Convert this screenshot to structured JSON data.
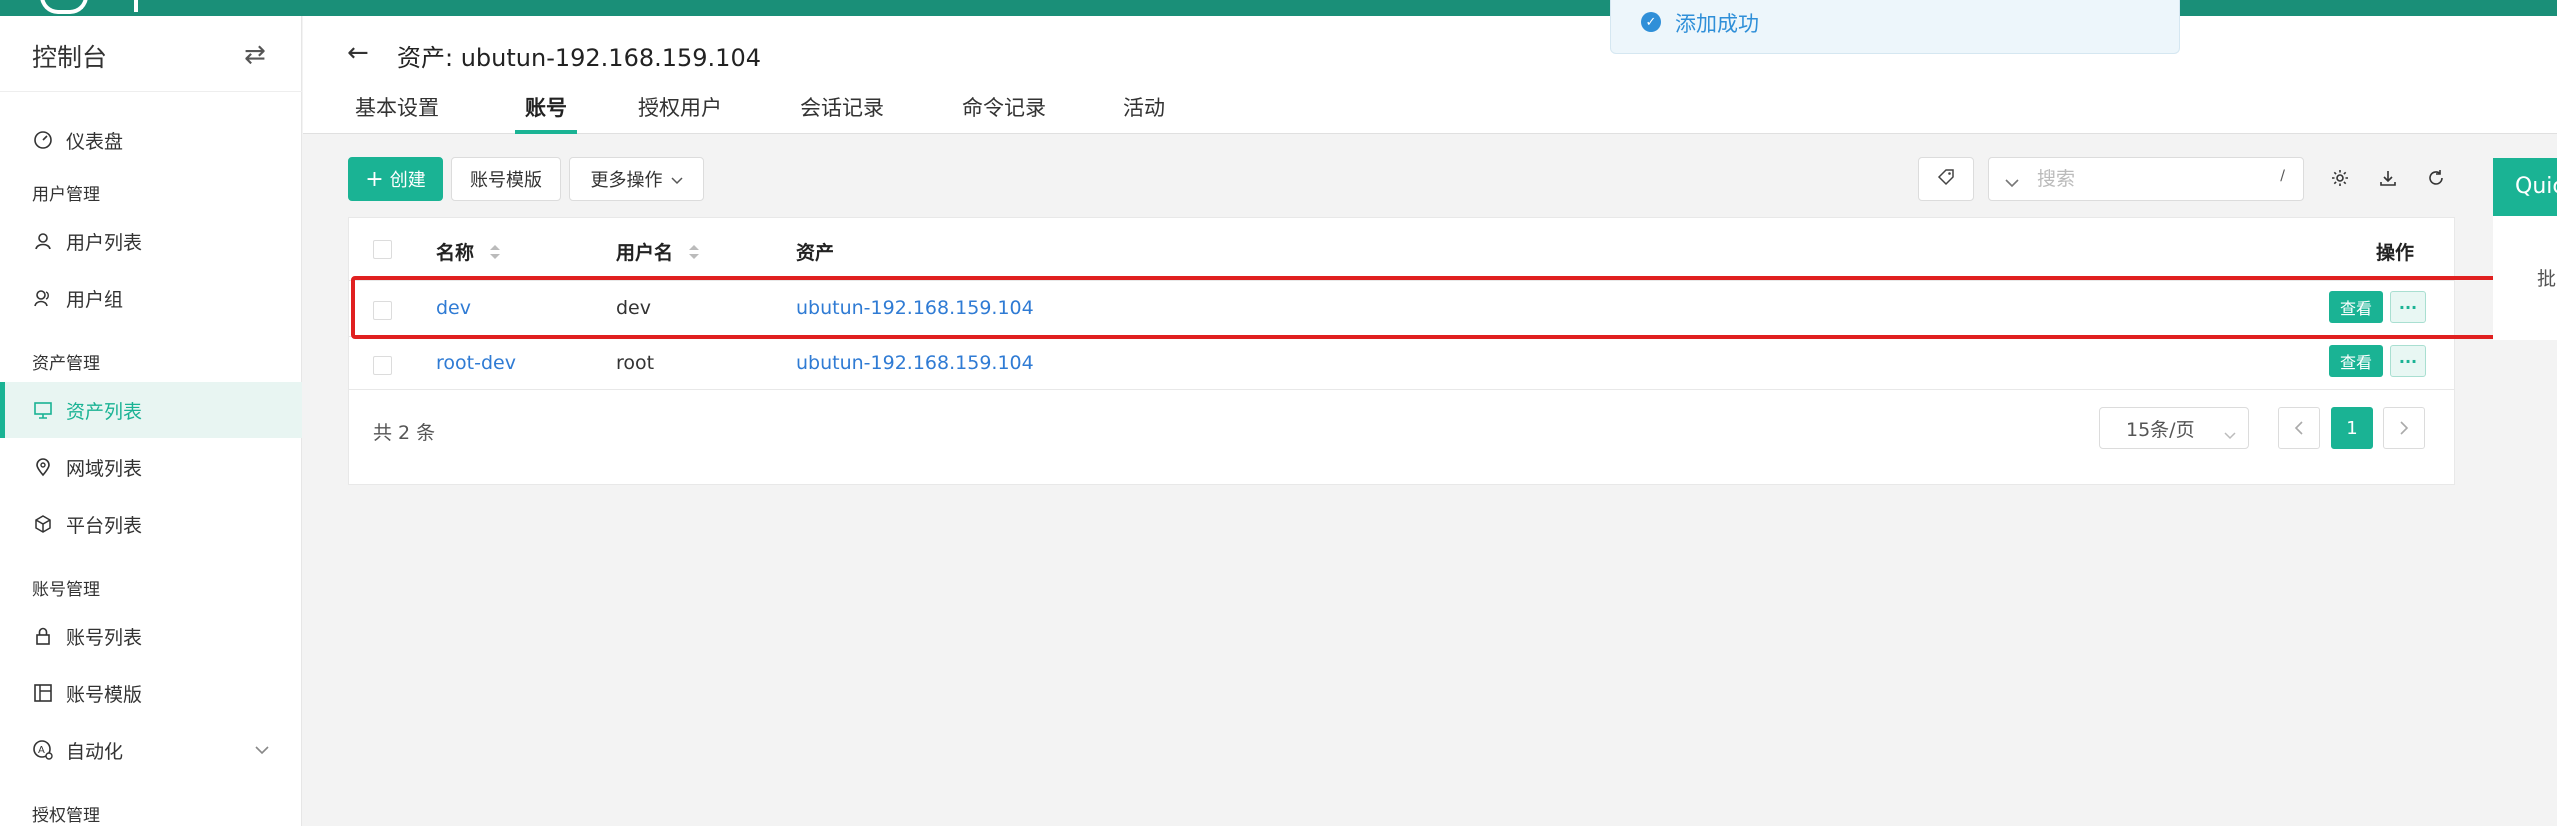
{
  "colors": {
    "brand": "#1ab394",
    "topbar": "#1a8f78",
    "link": "#2f7bd4",
    "highlight": "#e02020"
  },
  "sidebar": {
    "title": "控制台",
    "switch_icon": "swap-icon",
    "items": [
      {
        "label": "仪表盘",
        "icon": "dashboard-icon"
      },
      {
        "group": "用户管理"
      },
      {
        "label": "用户列表",
        "icon": "user-icon"
      },
      {
        "label": "用户组",
        "icon": "users-icon"
      },
      {
        "group": "资产管理"
      },
      {
        "label": "资产列表",
        "icon": "monitor-icon",
        "active": true
      },
      {
        "label": "网域列表",
        "icon": "location-icon"
      },
      {
        "label": "平台列表",
        "icon": "cube-icon"
      },
      {
        "group": "账号管理"
      },
      {
        "label": "账号列表",
        "icon": "lock-icon"
      },
      {
        "label": "账号模版",
        "icon": "template-icon"
      },
      {
        "label": "自动化",
        "icon": "automation-icon"
      },
      {
        "group": "授权管理"
      }
    ]
  },
  "header": {
    "title": "资产: ubutun-192.168.159.104",
    "tabs": [
      "基本设置",
      "账号",
      "授权用户",
      "会话记录",
      "命令记录",
      "活动"
    ],
    "active_tab": "账号"
  },
  "toast": {
    "text": "添加成功"
  },
  "toolbar": {
    "create_label": "创建",
    "template_label": "账号模版",
    "more_label": "更多操作",
    "search_placeholder": "搜索",
    "search_shortcut": "/"
  },
  "table": {
    "columns": [
      "名称",
      "用户名",
      "资产",
      "操作"
    ],
    "rows": [
      {
        "name": "dev",
        "username": "dev",
        "asset": "ubutun-192.168.159.104",
        "view": "查看",
        "more": "···"
      },
      {
        "name": "root-dev",
        "username": "root",
        "asset": "ubutun-192.168.159.104",
        "view": "查看",
        "more": "···"
      }
    ],
    "total_text": "共 2 条",
    "page_size": "15条/页",
    "current_page": "1"
  },
  "drawer": {
    "title": "Quic",
    "text": "批"
  }
}
